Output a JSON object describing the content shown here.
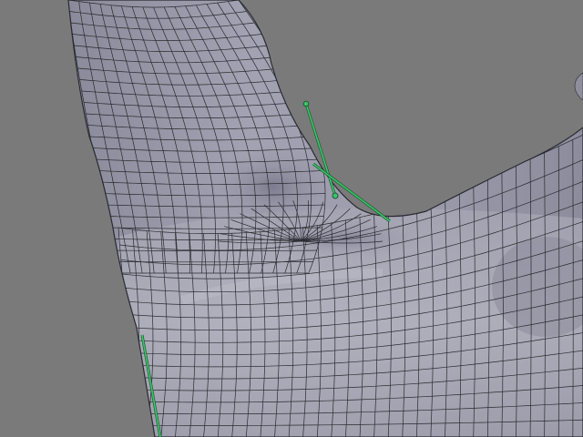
{
  "viewport": {
    "background_color": "#7a7a7a",
    "mesh_color": "#9c9cab",
    "mesh_highlight_color": "#bdbdc8",
    "mesh_shadow_color": "#6c6c7c",
    "wire_color": "#1e1e24",
    "armature_color": "#3cc46a"
  }
}
